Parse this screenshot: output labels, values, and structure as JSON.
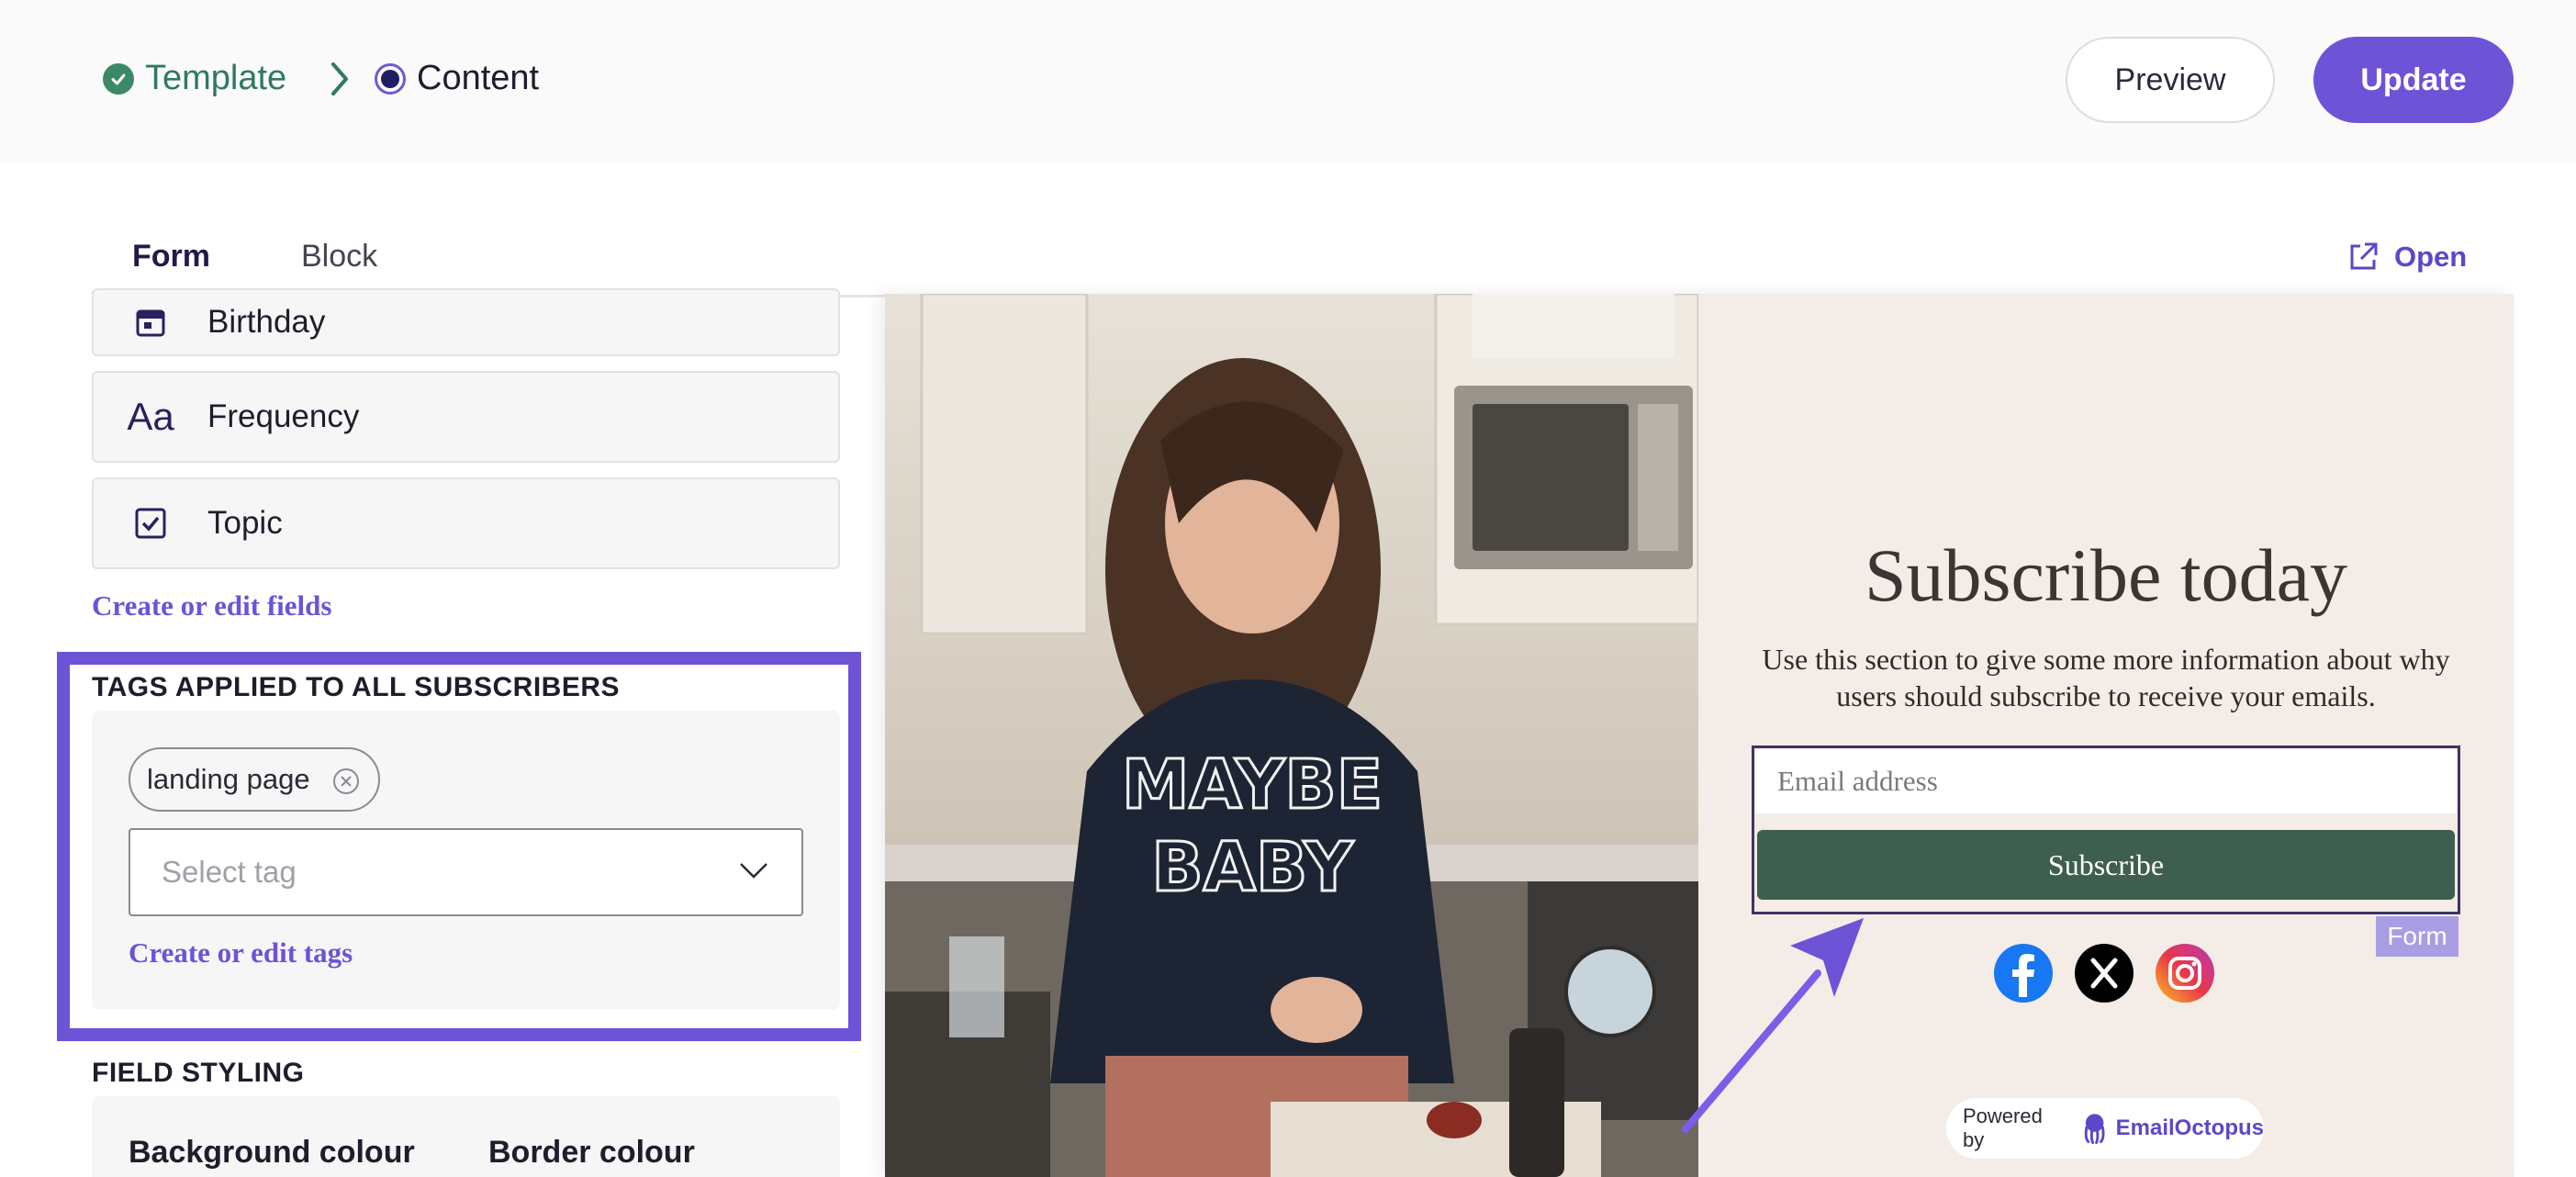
{
  "breadcrumb": {
    "step1": "Template",
    "step2": "Content"
  },
  "header": {
    "preview_label": "Preview",
    "update_label": "Update"
  },
  "tabs": [
    {
      "label": "Form",
      "active": true
    },
    {
      "label": "Block",
      "active": false
    }
  ],
  "open_link": "Open",
  "fields": [
    {
      "label": "Birthday",
      "icon": "calendar-icon"
    },
    {
      "label": "Frequency",
      "icon": "text-aa-icon"
    },
    {
      "label": "Topic",
      "icon": "checkbox-icon"
    }
  ],
  "create_fields_link": "Create or edit fields",
  "tags": {
    "title": "TAGS APPLIED TO ALL SUBSCRIBERS",
    "applied": [
      "landing page"
    ],
    "select_placeholder": "Select tag",
    "create_link": "Create or edit tags"
  },
  "field_styling": {
    "title": "FIELD STYLING",
    "background_label": "Background colour",
    "border_label": "Border colour"
  },
  "preview": {
    "title": "Subscribe today",
    "description": "Use this section to give some more information about why users should subscribe to receive your emails.",
    "email_placeholder": "Email address",
    "button_label": "Subscribe",
    "form_badge": "Form",
    "social": [
      "facebook-icon",
      "x-icon",
      "instagram-icon"
    ],
    "powered_by": "Powered by",
    "brand": "EmailOctopus",
    "shirt_text": "MAYBE BABY"
  },
  "colors": {
    "accent": "#6d53d6",
    "success": "#3b8a67",
    "subscribe_button": "#3e5f4f",
    "preview_bg": "#f4ece6"
  }
}
